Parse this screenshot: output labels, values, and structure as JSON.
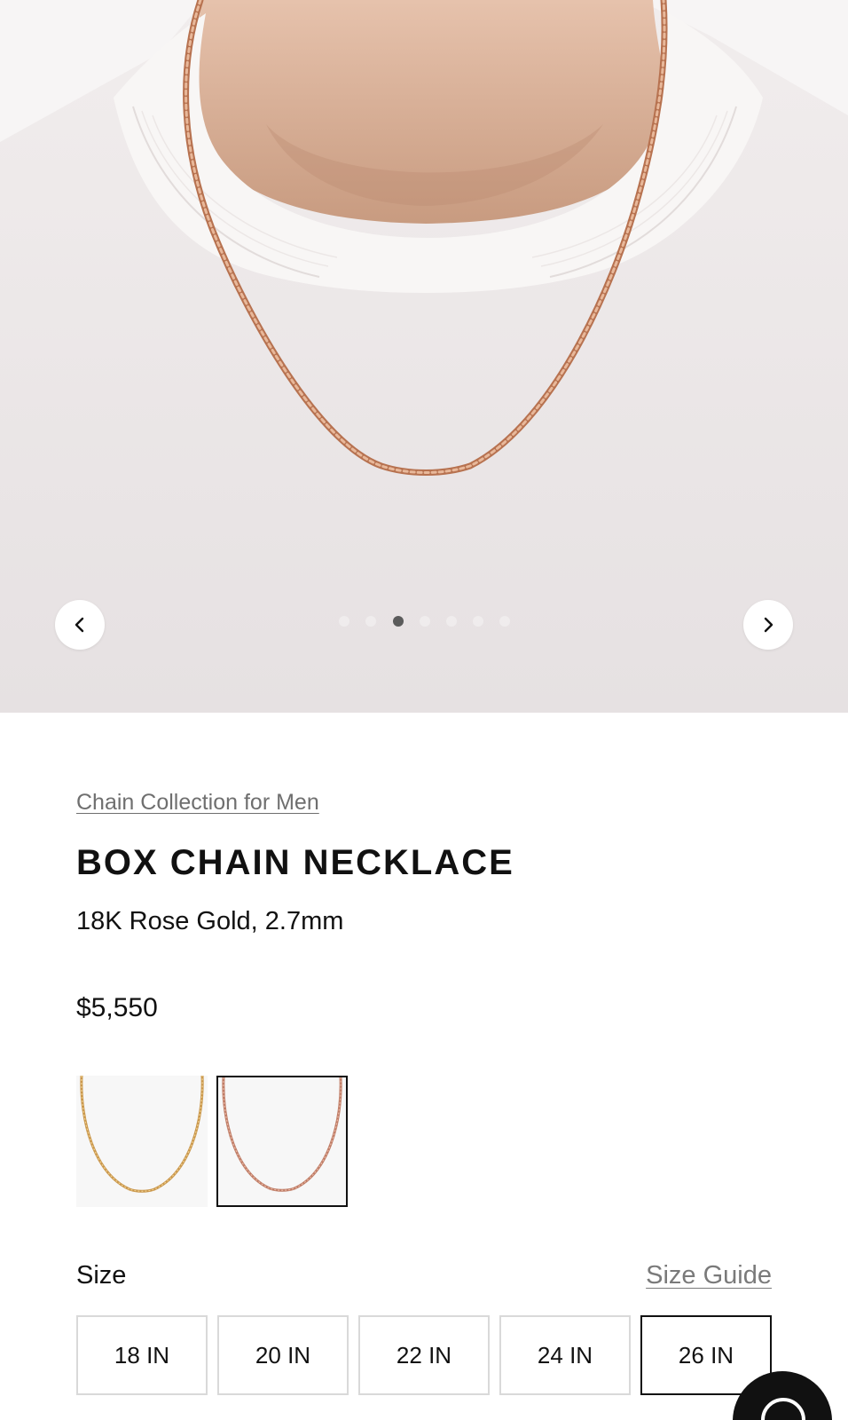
{
  "gallery": {
    "prev_icon": "chevron-left-icon",
    "next_icon": "chevron-right-icon",
    "slide_count": 7,
    "active_slide": 3
  },
  "product": {
    "collection_link": "Chain Collection for Men",
    "title": "BOX CHAIN NECKLACE",
    "subtitle": "18K Rose Gold, 2.7mm",
    "price": "$5,550"
  },
  "swatches": [
    {
      "name": "yellow-gold",
      "selected": false
    },
    {
      "name": "rose-gold",
      "selected": true
    }
  ],
  "size": {
    "label": "Size",
    "guide_link": "Size Guide",
    "options": [
      "18 IN",
      "20 IN",
      "22 IN",
      "24 IN",
      "26 IN"
    ],
    "selected": "26 IN"
  },
  "chat": {
    "icon": "chat-bubble-icon"
  },
  "colors": {
    "text": "#111111",
    "muted_link": "#6f6f6f",
    "border": "#d9d9d9",
    "rose_gold": "#c98a66",
    "yellow_gold": "#d2a45a"
  }
}
